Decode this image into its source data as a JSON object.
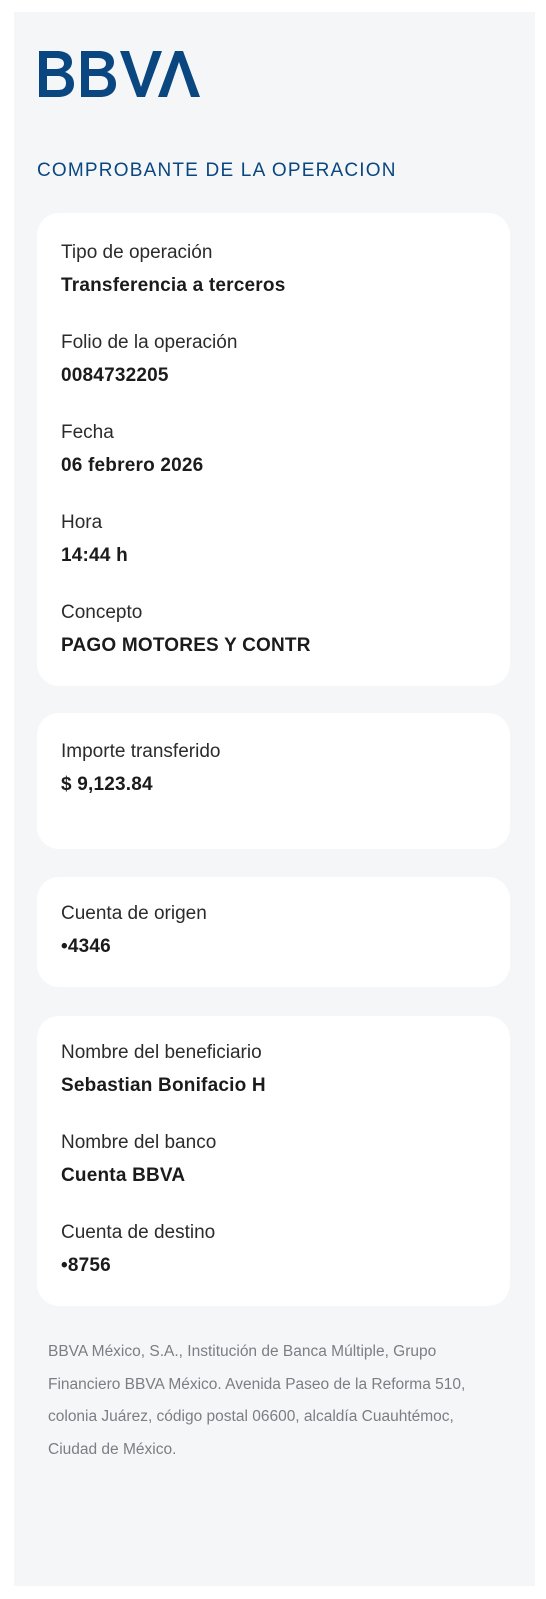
{
  "header": {
    "logo": "BBVA",
    "title": "COMPROBANTE DE LA OPERACION"
  },
  "operation": {
    "type_label": "Tipo de operación",
    "type_value": "Transferencia a terceros",
    "folio_label": "Folio de la operación",
    "folio_value": "0084732205",
    "date_label": "Fecha",
    "date_value": "06 febrero 2026",
    "time_label": "Hora",
    "time_value": "14:44 h",
    "concept_label": "Concepto",
    "concept_value": "PAGO MOTORES Y CONTR"
  },
  "amount": {
    "label": "Importe transferido",
    "value": "$ 9,123.84"
  },
  "origin": {
    "label": "Cuenta de origen",
    "value": "•4346"
  },
  "beneficiary": {
    "name_label": "Nombre del beneficiario",
    "name_value": "Sebastian Bonifacio H",
    "bank_label": "Nombre del banco",
    "bank_value": "Cuenta BBVA",
    "dest_label": "Cuenta de destino",
    "dest_value": "•8756"
  },
  "footer": {
    "text": "BBVA México, S.A., Institución de Banca Múltiple, Grupo Financiero BBVA México. Avenida Paseo de la Reforma 510, colonia Juárez, código postal 06600, alcaldía Cuauhtémoc, Ciudad de México."
  },
  "colors": {
    "brand": "#0a4680",
    "background": "#f4f6f7",
    "card": "#ffffff",
    "footer_text": "#7a7f85"
  }
}
